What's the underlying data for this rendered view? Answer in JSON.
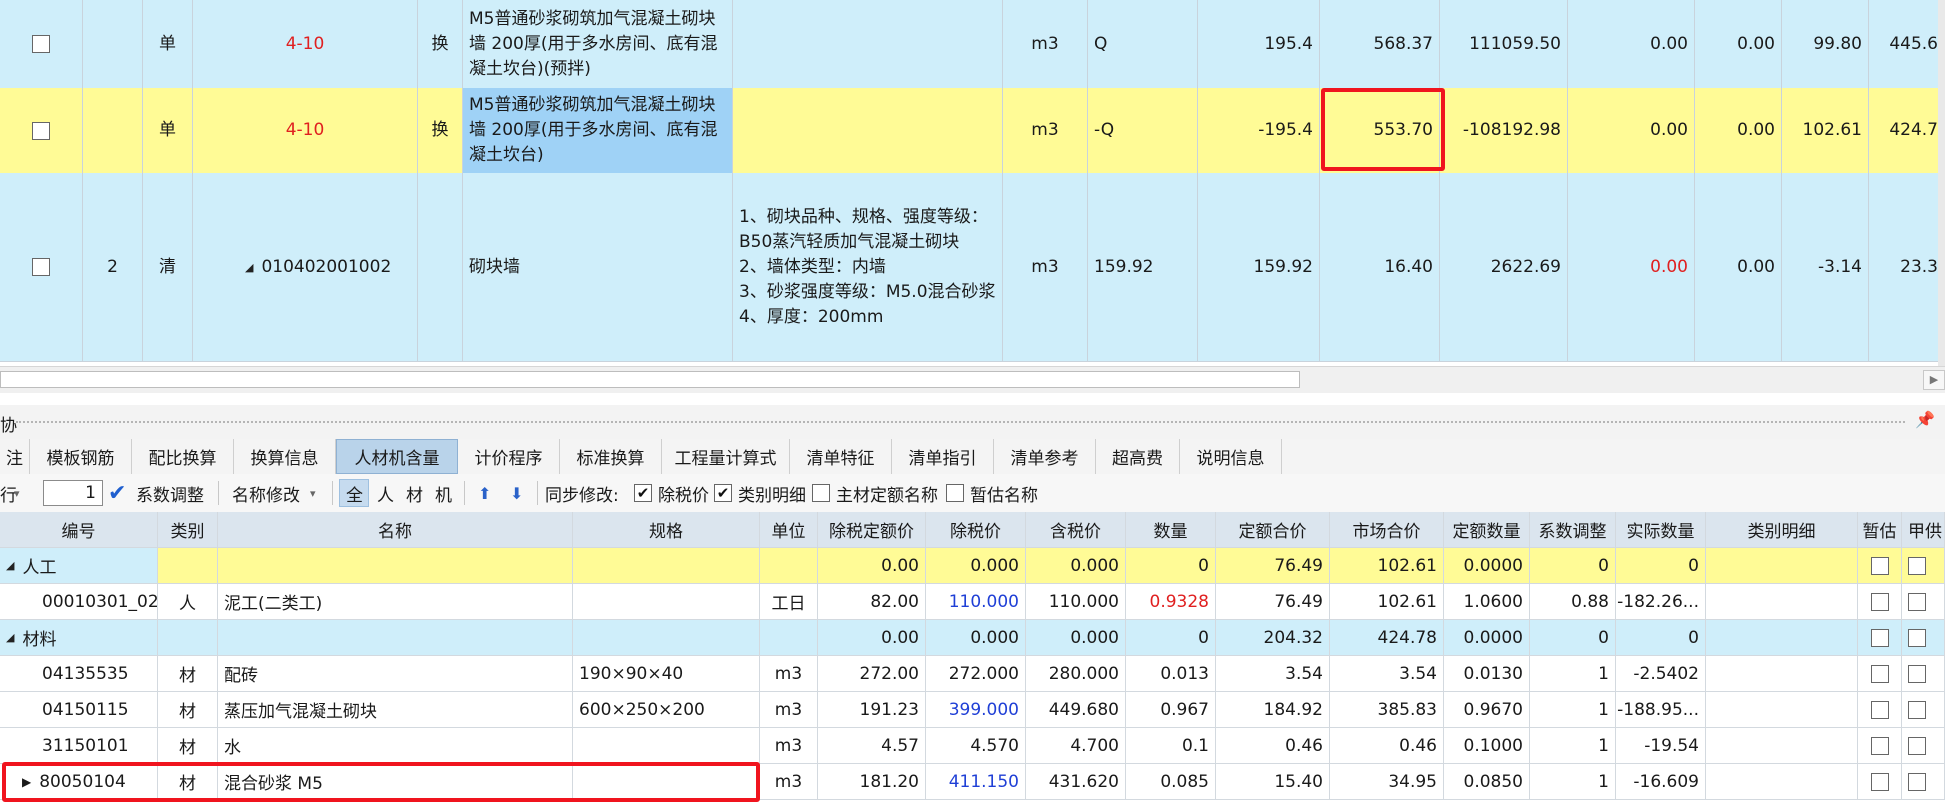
{
  "top_rows": [
    {
      "type": "单",
      "code": "4-10",
      "code_color": "#e02020",
      "swap": "换",
      "name": "M5普通砂浆砌筑加气混凝土砌块墙 200厚(用于多水房间、底有混凝土坎台)(预拌)",
      "feature": "",
      "unit": "m3",
      "expr": "Q",
      "qty": "195.4",
      "price": "568.37",
      "total": "111059.50",
      "c1": "0.00",
      "c2": "0.00",
      "c3": "99.80",
      "c4": "445.6"
    },
    {
      "type": "单",
      "code": "4-10",
      "code_color": "#e02020",
      "swap": "换",
      "name": "M5普通砂浆砌筑加气混凝土砌块墙 200厚(用于多水房间、底有混凝土坎台)",
      "feature": "",
      "unit": "m3",
      "expr": "-Q",
      "qty": "-195.4",
      "price": "553.70",
      "total": "-108192.98",
      "c1": "0.00",
      "c2": "0.00",
      "c3": "102.61",
      "c4": "424.7"
    },
    {
      "num": "2",
      "type": "清",
      "code": "010402001002",
      "swap": "",
      "name": "砌块墙",
      "feature": "1、砌块品种、规格、强度等级：B50蒸汽轻质加气混凝土砌块\n2、墙体类型：内墙\n3、砂浆强度等级：M5.0混合砂浆\n4、厚度：200mm",
      "unit": "m3",
      "expr": "159.92",
      "qty": "159.92",
      "price": "16.40",
      "total": "2622.69",
      "c1": "0.00",
      "c2": "0.00",
      "c3": "-3.14",
      "c4": "23.3"
    }
  ],
  "splitter_label": "协",
  "tabs": [
    "注",
    "模板钢筋",
    "配比换算",
    "换算信息",
    "人材机含量",
    "计价程序",
    "标准换算",
    "工程量计算式",
    "清单特征",
    "清单指引",
    "清单参考",
    "超高费",
    "说明信息"
  ],
  "active_tab": "人材机含量",
  "toolbar": {
    "row_label": "行",
    "row_value": "1",
    "coef_adjust": "系数调整",
    "name_modify": "名称修改",
    "filters": [
      "全",
      "人",
      "材",
      "机"
    ],
    "sync_label": "同步修改:",
    "opt_excl_tax": "除税价",
    "opt_category_detail": "类别明细",
    "opt_main_material": "主材定额名称",
    "opt_provisional": "暂估名称"
  },
  "columns": [
    "编号",
    "类别",
    "名称",
    "规格",
    "单位",
    "除税定额价",
    "除税价",
    "含税价",
    "数量",
    "定额合价",
    "市场合价",
    "定额数量",
    "系数调整",
    "实际数量",
    "类别明细",
    "暂估",
    "甲供"
  ],
  "groups": [
    {
      "label": "人工",
      "values": [
        "0.00",
        "0.000",
        "0.000",
        "0",
        "76.49",
        "102.61",
        "0.0000",
        "0",
        "0"
      ]
    },
    {
      "label": "材料",
      "values": [
        "0.00",
        "0.000",
        "0.000",
        "0",
        "204.32",
        "424.78",
        "0.0000",
        "0",
        "0"
      ]
    }
  ],
  "rows": [
    {
      "code": "00010301_02",
      "cat": "人",
      "name": "泥工(二类工)",
      "spec": "",
      "unit": "工日",
      "p1": "82.00",
      "p2": "110.000",
      "p3": "110.000",
      "qty": "0.9328",
      "sum1": "76.49",
      "sum2": "102.61",
      "dq": "1.0600",
      "coef": "0.88",
      "actual": "-182.26..."
    },
    {
      "code": "04135535",
      "cat": "材",
      "name": "配砖",
      "spec": "190×90×40",
      "unit": "m3",
      "p1": "272.00",
      "p2": "272.000",
      "p3": "280.000",
      "qty": "0.013",
      "sum1": "3.54",
      "sum2": "3.54",
      "dq": "0.0130",
      "coef": "1",
      "actual": "-2.5402"
    },
    {
      "code": "04150115",
      "cat": "材",
      "name": "蒸压加气混凝土砌块",
      "spec": "600×250×200",
      "unit": "m3",
      "p1": "191.23",
      "p2": "399.000",
      "p3": "449.680",
      "qty": "0.967",
      "sum1": "184.92",
      "sum2": "385.83",
      "dq": "0.9670",
      "coef": "1",
      "actual": "-188.95..."
    },
    {
      "code": "31150101",
      "cat": "材",
      "name": "水",
      "spec": "",
      "unit": "m3",
      "p1": "4.57",
      "p2": "4.570",
      "p3": "4.700",
      "qty": "0.1",
      "sum1": "0.46",
      "sum2": "0.46",
      "dq": "0.1000",
      "coef": "1",
      "actual": "-19.54"
    },
    {
      "code": "80050104",
      "cat": "材",
      "name": "混合砂浆 M5",
      "spec": "",
      "unit": "m3",
      "p1": "181.20",
      "p2": "411.150",
      "p3": "431.620",
      "qty": "0.085",
      "sum1": "15.40",
      "sum2": "34.95",
      "dq": "0.0850",
      "coef": "1",
      "actual": "-16.609"
    }
  ],
  "colors": {
    "yellow": "#fffb96",
    "light_blue": "#cfeefa",
    "highlight_red": "#f0141e",
    "value_blue": "#1f3fd6",
    "value_red": "#e02020"
  }
}
